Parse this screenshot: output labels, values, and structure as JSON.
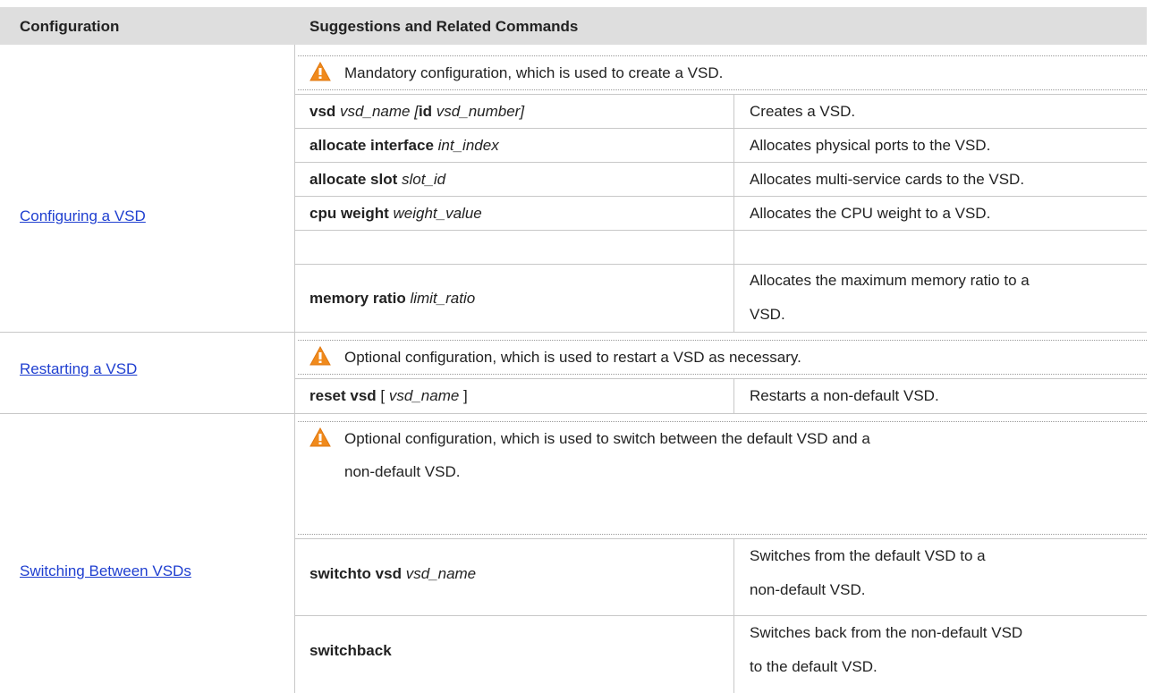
{
  "header": {
    "col1": "Configuration",
    "col2": "Suggestions and Related Commands"
  },
  "sections": [
    {
      "link": "Configuring a VSD",
      "note": "Mandatory configuration, which is used to create a VSD.",
      "rows": [
        {
          "kw1": "vsd",
          "arg1": "vsd_name",
          "mid": "[",
          "kw2": "id",
          "arg2": "vsd_number]",
          "desc": "Creates a VSD."
        },
        {
          "kw1": "allocate interface",
          "arg1": "int_index",
          "desc": "Allocates physical ports to the VSD."
        },
        {
          "kw1": "allocate slot",
          "arg1": "slot_id",
          "desc": "Allocates multi-service cards to the VSD."
        },
        {
          "kw1": "cpu weight",
          "arg1": "weight_value",
          "desc": "Allocates the CPU weight to a VSD."
        },
        {
          "kw1": "memory ratio",
          "arg1": "limit_ratio",
          "desc1": "Allocates the maximum memory ratio to a",
          "desc2": "VSD."
        }
      ]
    },
    {
      "link": "Restarting a VSD",
      "note": "Optional configuration, which is used to restart a VSD as necessary.",
      "rows": [
        {
          "kw1": "reset vsd",
          "pre": "[",
          "arg1": "vsd_name",
          "post": "]",
          "desc": "Restarts a non-default VSD."
        }
      ]
    },
    {
      "link": "Switching Between VSDs",
      "note1": "Optional configuration, which is used to switch between the default VSD and a",
      "note2": "non-default VSD.",
      "rows": [
        {
          "kw1": "switchto vsd",
          "arg1": "vsd_name",
          "desc1": "Switches from the default VSD to a",
          "desc2": "non-default VSD."
        },
        {
          "kw1": "switchback",
          "desc1": "Switches back from the non-default VSD",
          "desc2": "to the default VSD."
        }
      ]
    }
  ],
  "icons": {
    "warning": "warning-triangle-icon"
  },
  "colors": {
    "header_bg": "#dedede",
    "link": "#1f3fd0",
    "warning": "#f08a1c"
  }
}
